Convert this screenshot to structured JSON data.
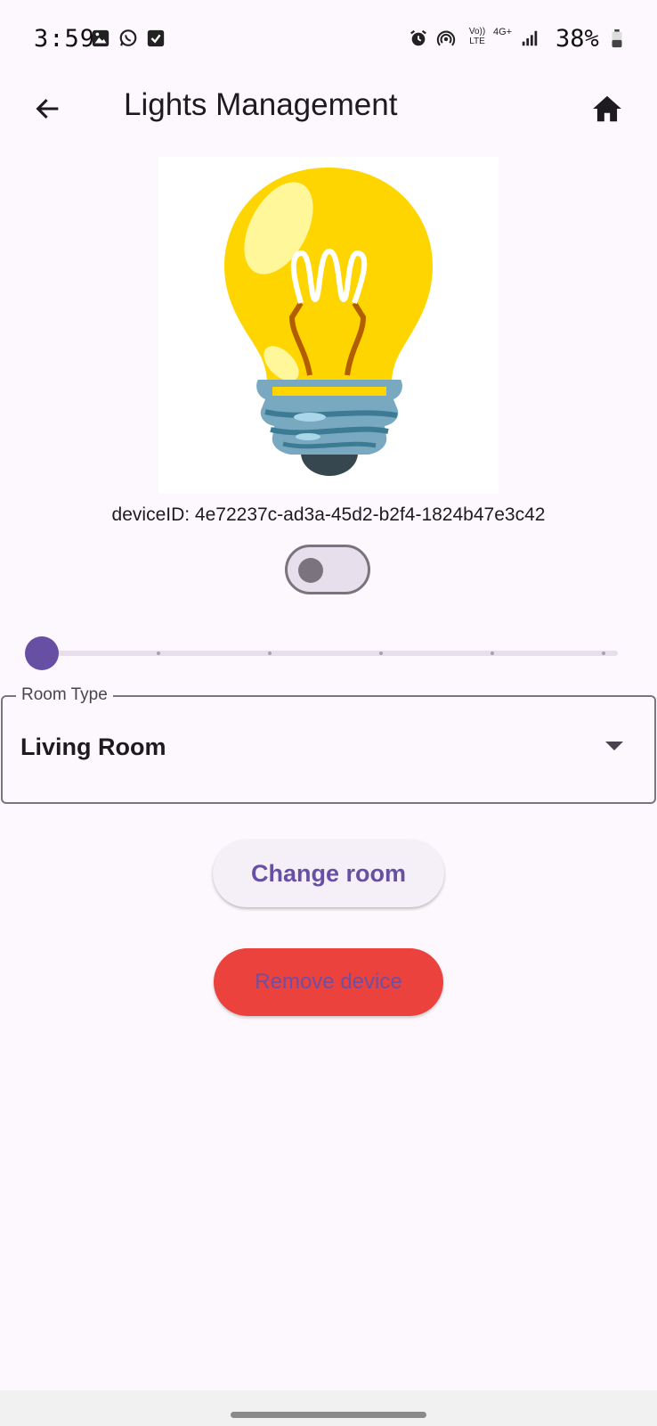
{
  "status_bar": {
    "time": "3:59",
    "battery": "38%",
    "network": "4G+",
    "volte": "Vo)) LTE"
  },
  "app_bar": {
    "title": "Lights Management"
  },
  "device": {
    "id_text": "deviceID: 4e72237c-ad3a-45d2-b2f4-1824b47e3c42",
    "power_on": false,
    "brightness_fraction": 0.0
  },
  "room": {
    "label": "Room Type",
    "selected": "Living Room"
  },
  "buttons": {
    "change_room": "Change room",
    "remove_device": "Remove device"
  },
  "colors": {
    "accent": "#6750a4",
    "danger": "#eb423d",
    "background": "#fdf8fd"
  }
}
